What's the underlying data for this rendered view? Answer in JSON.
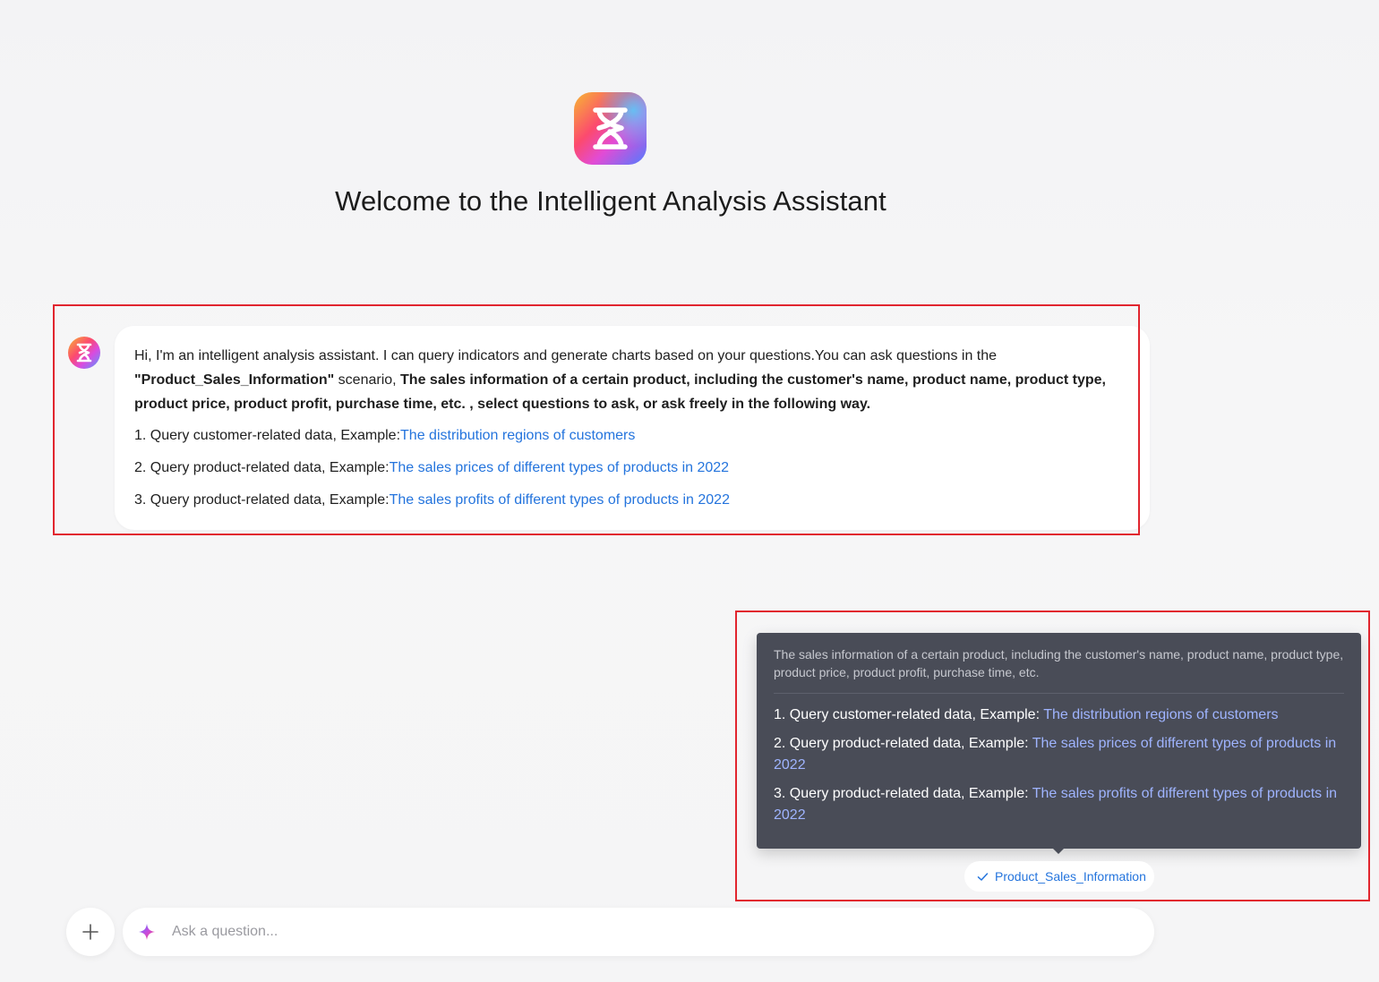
{
  "header": {
    "title": "Welcome to the Intelligent Analysis Assistant"
  },
  "message": {
    "intro_prefix": "Hi, I'm an intelligent analysis assistant. I can query indicators and generate charts based on your questions.You can ask questions in the ",
    "scenario_name": "\"Product_Sales_Information\"",
    "scenario_word": " scenario, ",
    "scenario_desc": "The sales information of a certain product, including the customer's name, product name, product type, product price, product profit, purchase time, etc. , select questions to ask, or ask freely in the following way.",
    "examples": [
      {
        "prefix": "1. Query customer-related data, Example:",
        "link": "The distribution regions of customers"
      },
      {
        "prefix": "2. Query product-related data, Example:",
        "link": "The sales prices of different types of products in 2022"
      },
      {
        "prefix": "3. Query product-related data, Example:",
        "link": "The sales profits of different types of products in 2022"
      }
    ]
  },
  "tooltip": {
    "description": "The sales information of a certain product, including the customer's name, product name, product type, product price, product profit, purchase time, etc.",
    "items": [
      {
        "prefix": "1. Query customer-related data, Example: ",
        "link": "The distribution regions of customers"
      },
      {
        "prefix": "2. Query product-related data, Example: ",
        "link": "The sales prices of different types of products in 2022"
      },
      {
        "prefix": "3. Query product-related data, Example: ",
        "link": "The sales profits of different types of products in 2022"
      }
    ]
  },
  "scenario_chip": {
    "label": "Product_Sales_Information",
    "icon": "check-icon"
  },
  "input": {
    "placeholder": "Ask a question...",
    "value": ""
  },
  "icons": {
    "logo": "hourglass-logo-icon",
    "avatar": "hourglass-avatar-icon",
    "add": "plus-icon",
    "ai": "sparkle-icon"
  },
  "colors": {
    "link": "#2474dd",
    "tooltip_bg": "#494c57",
    "tooltip_link": "#9fb4ff",
    "highlight_border": "#e1252e"
  }
}
